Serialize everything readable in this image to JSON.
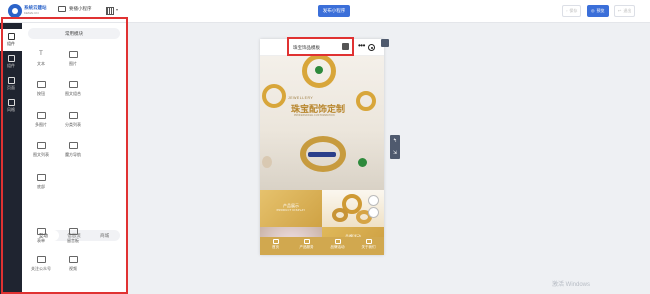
{
  "header": {
    "brand_name": "系统云建站",
    "brand_sub": "KEMAI.CN",
    "app_switch_label": "要播小程序",
    "publish_label": "发布小程序",
    "buttons": [
      {
        "label": "保存",
        "icon": "save-icon"
      },
      {
        "label": "预览",
        "icon": "preview-icon"
      },
      {
        "label": "退出",
        "icon": "exit-icon"
      }
    ]
  },
  "rail": {
    "items": [
      {
        "label": "组件",
        "icon": "plus-icon"
      },
      {
        "label": "组件",
        "icon": "list-icon"
      },
      {
        "label": "页面",
        "icon": "page-icon"
      },
      {
        "label": "风格",
        "icon": "brush-icon"
      }
    ]
  },
  "panel": {
    "section_title": "常用模块",
    "components": [
      {
        "label": "文本",
        "icon": "text-icon"
      },
      {
        "label": "图片",
        "icon": "image-icon"
      },
      {
        "label": "按钮",
        "icon": "button-icon"
      },
      {
        "label": "图文组合",
        "icon": "image-text-icon"
      },
      {
        "label": "多图片",
        "icon": "multi-image-icon"
      },
      {
        "label": "分类列表",
        "icon": "category-list-icon"
      },
      {
        "label": "图文列表",
        "icon": "image-list-icon"
      },
      {
        "label": "魔方导航",
        "icon": "grid-nav-icon"
      },
      {
        "label": "底部",
        "icon": "footer-icon"
      }
    ],
    "tabs": [
      "互动",
      "信息流",
      "商城"
    ],
    "components2": [
      {
        "label": "表单",
        "icon": "form-icon"
      },
      {
        "label": "留言板",
        "icon": "message-icon"
      },
      {
        "label": "关注公众号",
        "icon": "follow-icon"
      },
      {
        "label": "视频",
        "icon": "video-icon"
      }
    ]
  },
  "phone": {
    "title": "珠宝饰品模板",
    "banner": {
      "jewellery": "JEWELLERY",
      "title": "珠宝配饰定制",
      "subtitle": "PROFESSIONAL CUSTOMIZATION"
    },
    "tiles": [
      {
        "title": "产品展示",
        "sub": "PRODUCT DISPLAY"
      },
      {
        "title": "品牌活动",
        "sub": "BRAND ACTIVITY"
      }
    ],
    "tabbar": [
      {
        "label": "首页",
        "icon": "home-icon"
      },
      {
        "label": "产品服务",
        "icon": "product-icon"
      },
      {
        "label": "品牌活动",
        "icon": "activity-icon"
      },
      {
        "label": "关于我们",
        "icon": "about-icon"
      }
    ]
  },
  "watermark": "激活 Windows",
  "colors": {
    "accent": "#3b6fd9",
    "highlight": "#e03232",
    "gold": "#d1a84f",
    "rail": "#1f2430"
  }
}
